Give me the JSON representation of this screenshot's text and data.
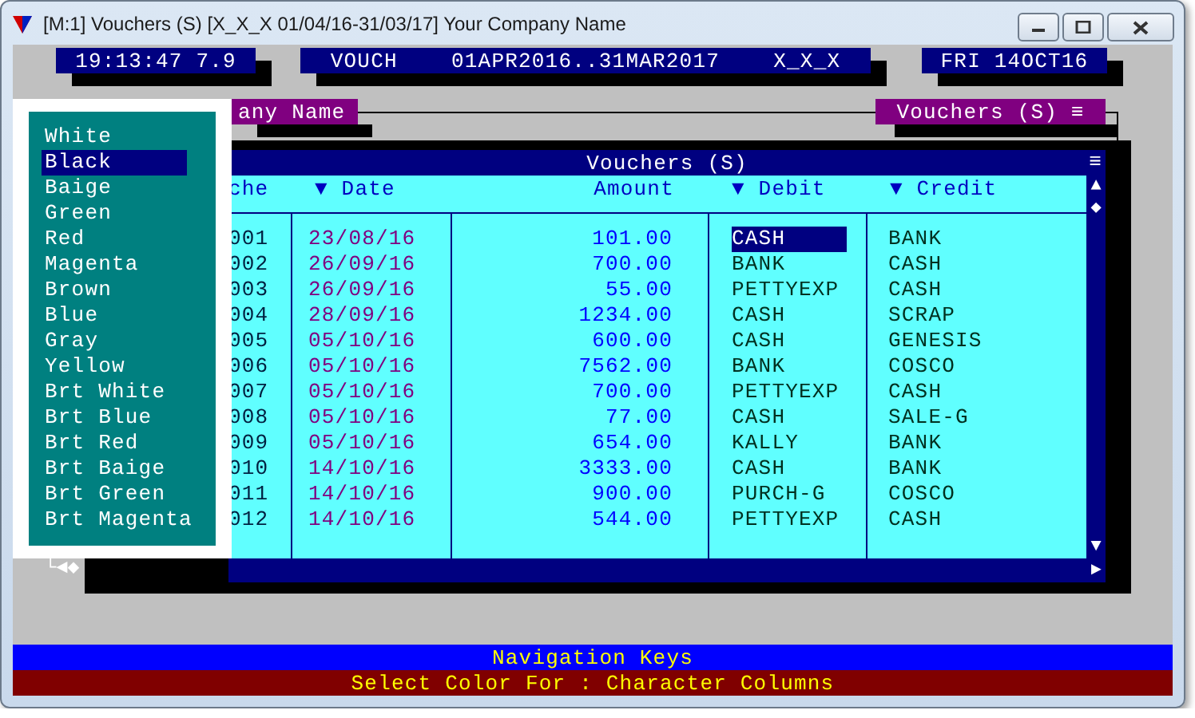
{
  "window": {
    "title": "[M:1]  Vouchers (S)  [X_X_X  01/04/16-31/03/17]  Your Company Name"
  },
  "info_boxes": [
    {
      "text": "19:13:47 7.9"
    },
    {
      "text": "VOUCH    01APR2016..31MAR2017    X_X_X"
    },
    {
      "text": "FRI 14OCT16"
    }
  ],
  "company_box": {
    "text": "any Name"
  },
  "module_box": {
    "text": "Vouchers (S) ≡"
  },
  "table": {
    "title": "Vouchers (S)",
    "menu_glyph": "≡",
    "columns": [
      {
        "label": "che"
      },
      {
        "label": "▼ Date"
      },
      {
        "label": "Amount"
      },
      {
        "label": "▼ Debit"
      },
      {
        "label": "▼ Credit"
      }
    ],
    "rows": [
      {
        "number": "001",
        "date": "23/08/16",
        "amount": "101.00",
        "debit": "CASH",
        "debit_selected": true,
        "credit": "BANK"
      },
      {
        "number": "002",
        "date": "26/09/16",
        "amount": "700.00",
        "debit": "BANK",
        "debit_selected": false,
        "credit": "CASH"
      },
      {
        "number": "003",
        "date": "26/09/16",
        "amount": "55.00",
        "debit": "PETTYEXP",
        "debit_selected": false,
        "credit": "CASH"
      },
      {
        "number": "004",
        "date": "28/09/16",
        "amount": "1234.00",
        "debit": "CASH",
        "debit_selected": false,
        "credit": "SCRAP"
      },
      {
        "number": "005",
        "date": "05/10/16",
        "amount": "600.00",
        "debit": "CASH",
        "debit_selected": false,
        "credit": "GENESIS"
      },
      {
        "number": "006",
        "date": "05/10/16",
        "amount": "7562.00",
        "debit": "BANK",
        "debit_selected": false,
        "credit": "COSCO"
      },
      {
        "number": "007",
        "date": "05/10/16",
        "amount": "700.00",
        "debit": "PETTYEXP",
        "debit_selected": false,
        "credit": "CASH"
      },
      {
        "number": "008",
        "date": "05/10/16",
        "amount": "77.00",
        "debit": "CASH",
        "debit_selected": false,
        "credit": "SALE-G"
      },
      {
        "number": "009",
        "date": "05/10/16",
        "amount": "654.00",
        "debit": "KALLY",
        "debit_selected": false,
        "credit": "BANK"
      },
      {
        "number": "010",
        "date": "14/10/16",
        "amount": "3333.00",
        "debit": "CASH",
        "debit_selected": false,
        "credit": "BANK"
      },
      {
        "number": "011",
        "date": "14/10/16",
        "amount": "900.00",
        "debit": "PURCH-G",
        "debit_selected": false,
        "credit": "COSCO"
      },
      {
        "number": "012",
        "date": "14/10/16",
        "amount": "544.00",
        "debit": "PETTYEXP",
        "debit_selected": false,
        "credit": "CASH"
      }
    ],
    "scroll_glyphs": {
      "up": "▲",
      "thumb": "◆",
      "down": "▼",
      "right": "►"
    }
  },
  "corner_marks": "└◄◆",
  "color_menu": {
    "items": [
      {
        "label": "White",
        "selected": false
      },
      {
        "label": "Black",
        "selected": true
      },
      {
        "label": "Baige",
        "selected": false
      },
      {
        "label": "Green",
        "selected": false
      },
      {
        "label": "Red",
        "selected": false
      },
      {
        "label": "Magenta",
        "selected": false
      },
      {
        "label": "Brown",
        "selected": false
      },
      {
        "label": "Blue",
        "selected": false
      },
      {
        "label": "Gray",
        "selected": false
      },
      {
        "label": "Yellow",
        "selected": false
      },
      {
        "label": "Brt White",
        "selected": false
      },
      {
        "label": "Brt Blue",
        "selected": false
      },
      {
        "label": "Brt Red",
        "selected": false
      },
      {
        "label": "Brt Baige",
        "selected": false
      },
      {
        "label": "Brt Green",
        "selected": false
      },
      {
        "label": "Brt Magenta",
        "selected": false
      }
    ]
  },
  "navigation_bar": {
    "text": "Navigation Keys"
  },
  "status_bar": {
    "text": "Select Color For : Character Columns"
  }
}
